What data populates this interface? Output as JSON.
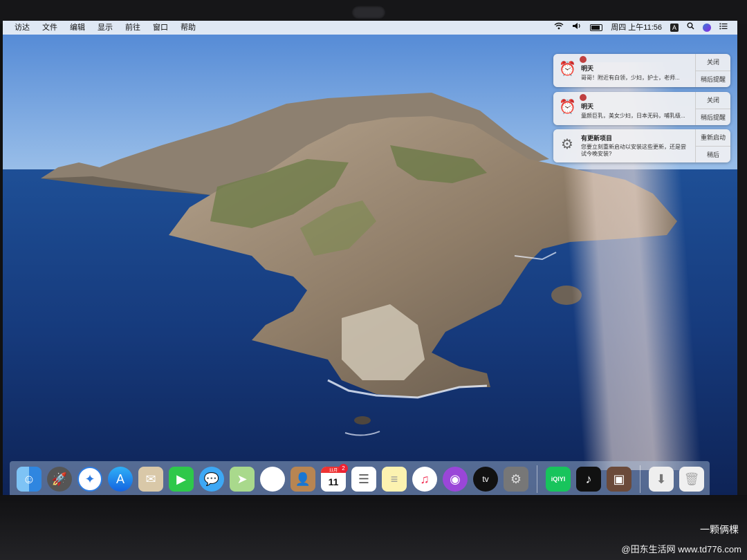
{
  "menubar": {
    "items": [
      "访达",
      "文件",
      "编辑",
      "显示",
      "前往",
      "窗口",
      "帮助"
    ],
    "clock": "周四 上午11:56",
    "input_method": "A",
    "icons": [
      "wifi-icon",
      "volume-icon",
      "battery-icon",
      "search-icon",
      "siri-icon",
      "notification-center-icon"
    ]
  },
  "notifications": [
    {
      "app_icon": "alarm-clock-icon",
      "title": "明天",
      "text": "哥哥！附近有白领，少妇，护士，老师...",
      "primary_action": "关闭",
      "secondary_action": "稍后提醒"
    },
    {
      "app_icon": "alarm-clock-icon",
      "title": "明天",
      "text": "童颜巨乳，美女少妇，日本无码，哺乳级...",
      "primary_action": "关闭",
      "secondary_action": "稍后提醒"
    },
    {
      "app_icon": "gear-icon",
      "title": "有更新项目",
      "text": "您要立刻重新启动以安装这些更新，还是尝试今晚安装?",
      "primary_action": "重新启动",
      "secondary_action": "稍后"
    }
  ],
  "dock": {
    "apps": [
      "finder",
      "launchpad",
      "safari",
      "app-store",
      "mail",
      "facetime",
      "messages",
      "maps",
      "photos",
      "contacts",
      "calendar",
      "reminders",
      "notes",
      "music",
      "podcasts",
      "tv",
      "system-preferences",
      "iqiyi",
      "tiktok",
      "photo-booth",
      "downloads",
      "trash"
    ],
    "calendar_month": "11月",
    "calendar_day": "11",
    "calendar_badge": "2",
    "tv_label": "tv",
    "iqiyi_label": "iQIYI"
  },
  "watermark": {
    "line1": "一颗俩棵",
    "line2": "@田东生活网 www.td776.com"
  },
  "colors": {
    "menubar": "#ECF0F6",
    "sea": "#1c3a7a",
    "notification_bg": "#F0F0F2"
  }
}
